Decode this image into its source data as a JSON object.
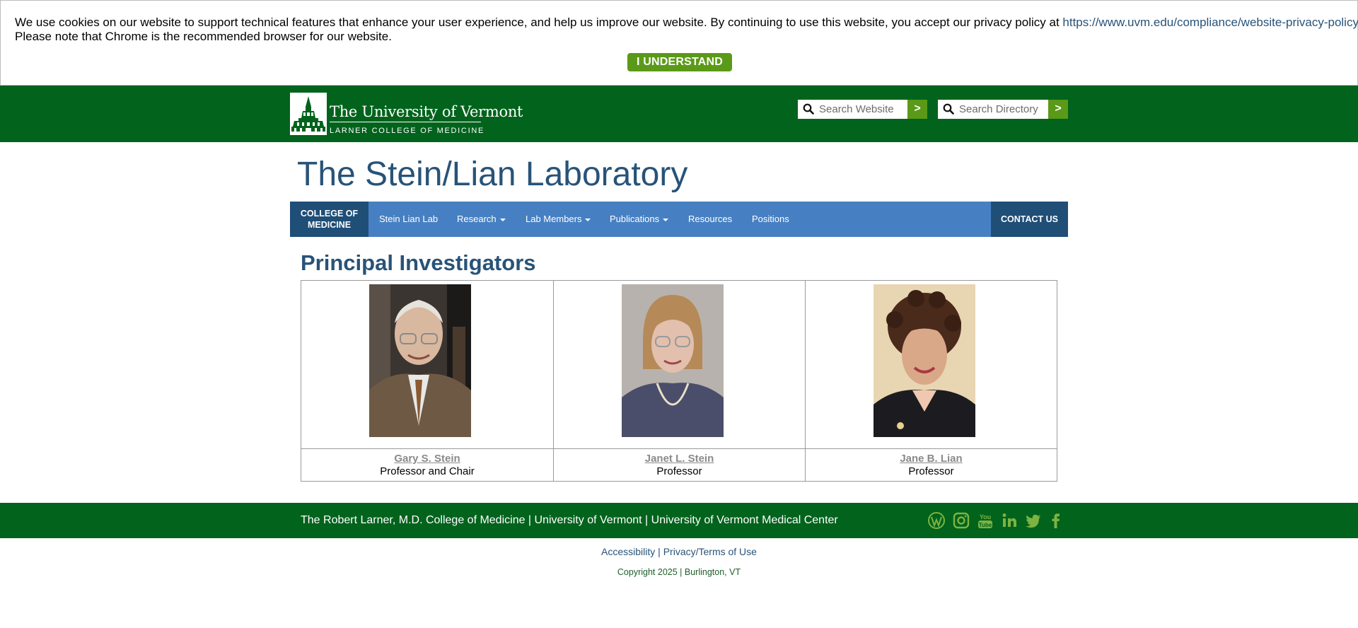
{
  "cookie_banner": {
    "message_line1": "We use cookies on our website to support technical features that enhance your user experience, and help us improve our website. By continuing to use this website, you accept our privacy policy at ",
    "policy_link": "https://www.uvm.edu/compliance/website-privacy-policy/terms-use",
    "message_line2": "Please note that Chrome is the recommended browser for our website.",
    "button_label": "I UNDERSTAND"
  },
  "header": {
    "logo_line1": "The University of Vermont",
    "logo_line2": "LARNER COLLEGE OF MEDICINE",
    "search_website": {
      "placeholder": "Search Website",
      "button": ">"
    },
    "search_directory": {
      "placeholder": "Search Directory",
      "button": ">"
    }
  },
  "site_title": "The Stein/Lian Laboratory",
  "nav": {
    "college_label_line1": "COLLEGE OF",
    "college_label_line2": "MEDICINE",
    "items": [
      {
        "label": "Stein Lian Lab",
        "dropdown": false
      },
      {
        "label": "Research",
        "dropdown": true
      },
      {
        "label": "Lab Members",
        "dropdown": true
      },
      {
        "label": "Publications",
        "dropdown": true
      },
      {
        "label": "Resources",
        "dropdown": false
      },
      {
        "label": "Positions",
        "dropdown": false
      }
    ],
    "contact_label": "CONTACT US"
  },
  "main": {
    "section_title": "Principal Investigators",
    "investigators": [
      {
        "name": "Gary S. Stein",
        "role": "Professor and Chair"
      },
      {
        "name": "Janet L. Stein",
        "role": "Professor"
      },
      {
        "name": "Jane B. Lian",
        "role": "Professor"
      }
    ]
  },
  "footer": {
    "text": "The Robert Larner, M.D. College of Medicine | University of Vermont | University of Vermont Medical Center",
    "social_icons": [
      "wordpress-icon",
      "instagram-icon",
      "youtube-icon",
      "linkedin-icon",
      "twitter-icon",
      "facebook-icon"
    ],
    "accessibility_link": "Accessibility",
    "separator": " | ",
    "privacy_link": "Privacy/Terms of Use",
    "copyright": "Copyright 2025 | Burlington, VT"
  },
  "colors": {
    "uvm_green": "#01631c",
    "accent_green": "#5a9a18",
    "nav_blue": "#4780c2",
    "nav_dark_blue": "#1f4e77",
    "title_blue": "#285378",
    "social_icon_green": "#7cb342"
  }
}
